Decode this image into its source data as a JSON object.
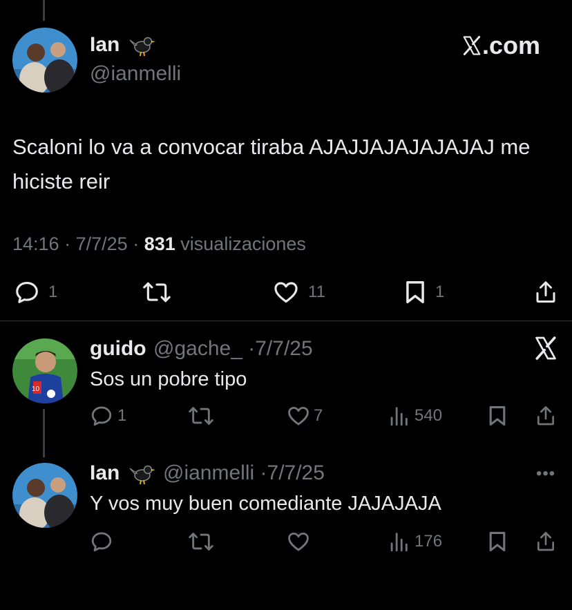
{
  "brand": {
    "label": "X.com"
  },
  "main_tweet": {
    "author_name": "Ian",
    "handle": "@ianmelli",
    "text": "Scaloni lo va a convocar tiraba AJAJJAJAJAJAJAJ me hiciste reir",
    "time": "14:16",
    "date": "7/7/25",
    "views_count": "831",
    "views_label": "visualizaciones",
    "actions": {
      "replies": "1",
      "likes": "11",
      "bookmarks": "1"
    },
    "separator": "·"
  },
  "replies": [
    {
      "author_name": "guido",
      "handle": "@gache_",
      "date": "7/7/25",
      "text": "Sos un pobre tipo",
      "actions": {
        "replies": "1",
        "likes": "7",
        "views": "540"
      }
    },
    {
      "author_name": "Ian",
      "handle": "@ianmelli",
      "date": "7/7/25",
      "text": "Y vos muy buen comediante JAJAJAJA",
      "actions": {
        "views": "176"
      }
    }
  ],
  "icons": {
    "reply": "reply-icon",
    "retweet": "retweet-icon",
    "like": "heart-icon",
    "bookmark": "bookmark-icon",
    "share": "share-icon",
    "views": "views-icon",
    "bird": "blackbird-icon",
    "x_logo": "x-logo-icon",
    "more": "more-icon"
  },
  "colors": {
    "background": "#000000",
    "text": "#e7e9ea",
    "muted": "#71767b",
    "divider": "#2f3336"
  }
}
